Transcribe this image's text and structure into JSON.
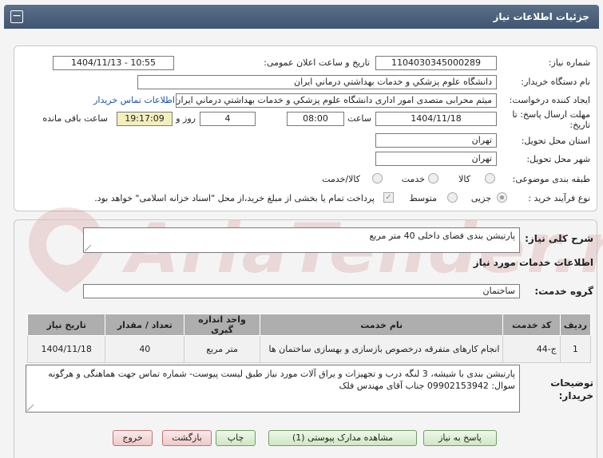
{
  "header": {
    "title": "جزئیات اطلاعات نیاز",
    "collapse_icon": "−"
  },
  "info": {
    "need_number_label": "شماره نیاز:",
    "need_number": "1104030345000289",
    "announce_label": "تاریخ و ساعت اعلان عمومی:",
    "announce_value": "1404/11/13 - 10:55",
    "buyer_label": "نام دستگاه خریدار:",
    "buyer_value": "دانشگاه علوم پزشکي و خدمات بهداشتي درماني ايران",
    "creator_label": "ایجاد کننده درخواست:",
    "creator_value": "میثم محرابی متصدی امور اداری دانشگاه علوم پزشکي و خدمات بهداشتي درماني ايران",
    "contact_link": "اطلاعات تماس خریدار",
    "deadline_label_1": "مهلت ارسال پاسخ: تا",
    "deadline_label_2": "تاریخ:",
    "deadline_date": "1404/11/18",
    "time_label": "ساعت",
    "deadline_time": "08:00",
    "days_value": "4",
    "days_label": "روز و",
    "remaining_time": "19:17:09",
    "remaining_label": "ساعت باقی مانده",
    "province_label": "استان محل تحویل:",
    "province_value": "تهران",
    "city_label": "شهر محل تحویل:",
    "city_value": "تهران",
    "category_label": "طبقه بندی موضوعی:",
    "category_options": [
      "کالا",
      "خدمت",
      "کالا/خدمت"
    ],
    "process_label": "نوع فرآیند خرید :",
    "process_options": [
      "جزیی",
      "متوسط"
    ],
    "payment_note": "پرداخت تمام یا بخشی از مبلغ خرید،از محل \"اسناد خزانه اسلامی\" خواهد بود."
  },
  "watermark": {
    "text": "AriaTender.net"
  },
  "need": {
    "summary_label": "شرح کلی نیاز:",
    "summary_value": "پارتیشن بندی فضای داخلی 40 متر مربع",
    "services_title": "اطلاعات خدمات مورد نیاز",
    "service_group_label": "گروه خدمت:",
    "service_group_value": "ساختمان"
  },
  "table": {
    "headers": [
      "ردیف",
      "کد خدمت",
      "نام خدمت",
      "واحد اندازه گیری",
      "تعداد / مقدار",
      "تاریخ نیاز"
    ],
    "rows": [
      [
        "1",
        "ج-44",
        "انجام کارهای متفرقه درخصوص بازسازی و بهسازی ساختمان ها",
        "متر مربع",
        "40",
        "1404/11/18"
      ]
    ]
  },
  "buyer_notes": {
    "label_1": "توضیحات",
    "label_2": "خریدار:",
    "text": "پارتیشن بندی با شیشه،  3 لنگه درب  و تجهیزات و یراق آلات مورد نیاز طبق لیست پیوست- شماره تماس جهت هماهنگی و هرگونه سوال:  09902153942 جناب آقای مهندس فلک"
  },
  "buttons": {
    "reply": "پاسخ به نیاز",
    "view_docs": "مشاهده مدارک پیوستی (1)",
    "print": "چاپ",
    "back": "بازگشت",
    "exit": "خروج"
  },
  "colors": {
    "header": "#4a607b",
    "highlight": "#f3efbd",
    "link": "#1b4fb0"
  }
}
